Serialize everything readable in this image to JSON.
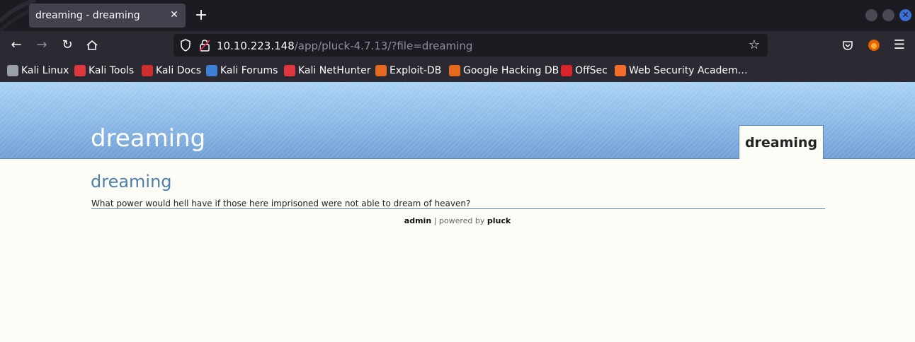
{
  "browser": {
    "tab": {
      "title": "dreaming - dreaming",
      "close_glyph": "✕"
    },
    "new_tab_glyph": "+",
    "url": {
      "host": "10.10.223.148",
      "path": "/app/pluck-4.7.13/?file=dreaming"
    },
    "bookmarks": [
      {
        "label": "Kali Linux",
        "icon": "kali-dragon-icon",
        "color": "#9aa0aa"
      },
      {
        "label": "Kali Tools",
        "icon": "kali-tools-icon",
        "color": "#e0373f"
      },
      {
        "label": "Kali Docs",
        "icon": "kali-docs-icon",
        "color": "#cf2e2e"
      },
      {
        "label": "Kali Forums",
        "icon": "kali-forums-icon",
        "color": "#3d7fd6"
      },
      {
        "label": "Kali NetHunter",
        "icon": "kali-nethunter-icon",
        "color": "#e0373f"
      },
      {
        "label": "Exploit-DB",
        "icon": "exploit-db-icon",
        "color": "#e56a1d"
      },
      {
        "label": "Google Hacking DB",
        "icon": "ghdb-icon",
        "color": "#e56a1d"
      },
      {
        "label": "OffSec",
        "icon": "offsec-icon",
        "color": "#d9262e"
      },
      {
        "label": "Web Security Academ…",
        "icon": "web-security-academy-icon",
        "color": "#f26c2b"
      }
    ]
  },
  "site": {
    "title": "dreaming",
    "nav_tab": "dreaming",
    "content": {
      "heading": "dreaming",
      "text": "What power would hell have if those here imprisoned were not able to dream of heaven?"
    },
    "footer": {
      "admin": "admin",
      "separator": " | powered by ",
      "brand": "pluck"
    }
  }
}
